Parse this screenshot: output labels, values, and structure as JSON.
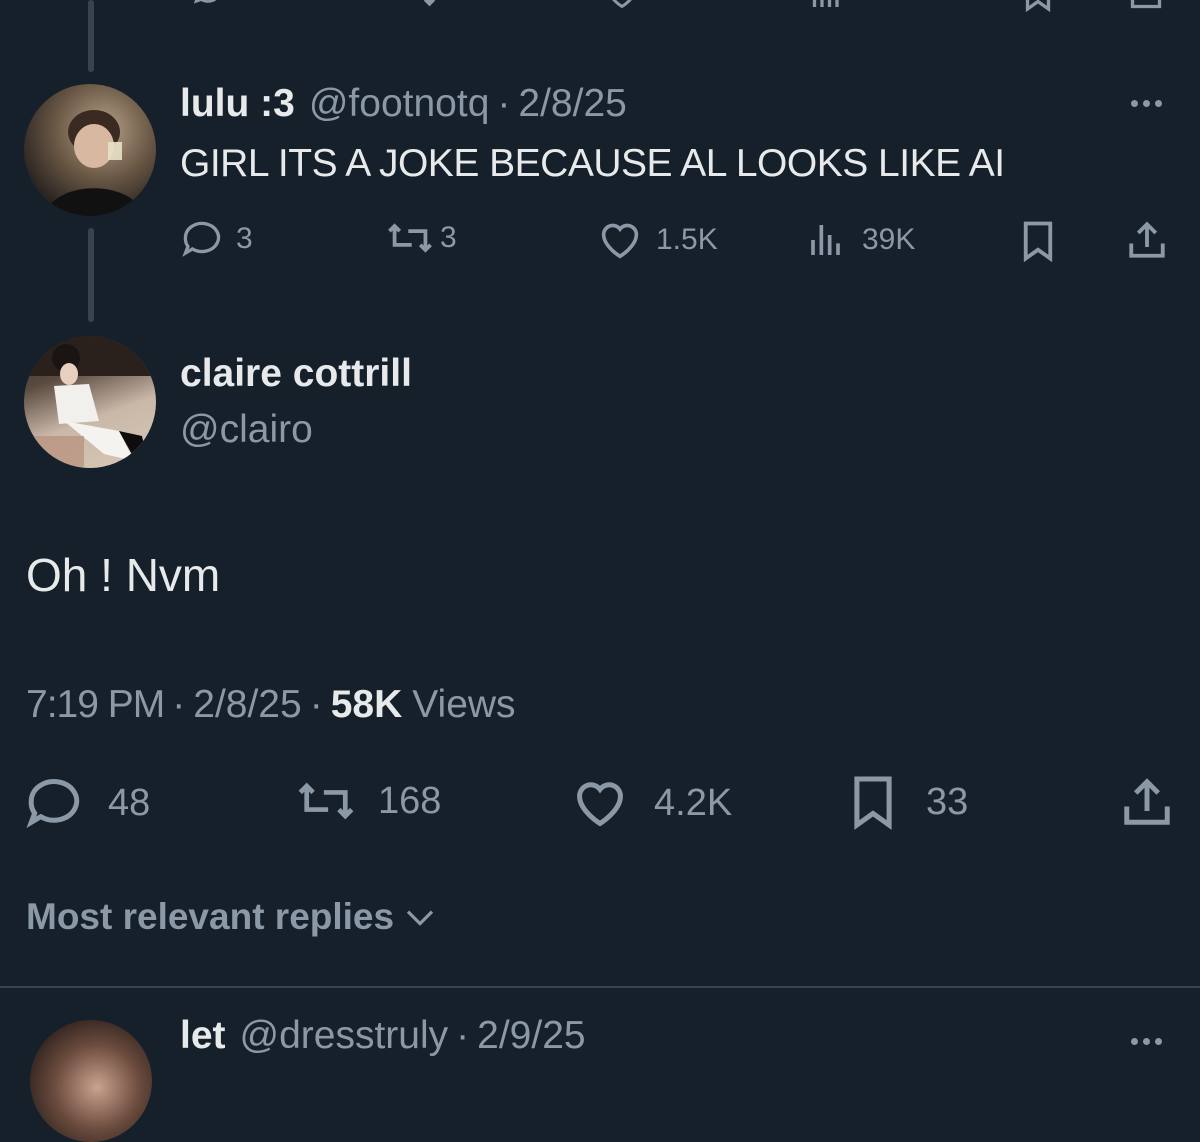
{
  "top_tweet_partial": {
    "icons": [
      "reply-icon",
      "retweet-icon",
      "like-icon",
      "views-icon",
      "bookmark-icon",
      "share-icon"
    ]
  },
  "reply1": {
    "display_name": "lulu :3",
    "handle": "@footnotq",
    "sep": "·",
    "date": "2/8/25",
    "text": "GIRL ITS A JOKE BECAUSE AL LOOKS LIKE AI",
    "stats": {
      "replies": "3",
      "retweets": "3",
      "likes": "1.5K",
      "views": "39K"
    }
  },
  "main_tweet": {
    "display_name": "claire cottrill",
    "handle": "@clairo",
    "text": "Oh ! Nvm",
    "time": "7:19 PM",
    "sep": "·",
    "date": "2/8/25",
    "views_count": "58K",
    "views_label": "Views",
    "stats": {
      "replies": "48",
      "retweets": "168",
      "likes": "4.2K",
      "bookmarks": "33"
    }
  },
  "replies_sort": {
    "label": "Most relevant replies"
  },
  "next_reply": {
    "display_name": "let",
    "handle": "@dresstruly",
    "sep": "·",
    "date": "2/9/25"
  },
  "colors": {
    "background": "#15202b",
    "text_primary": "#e7e9ea",
    "text_muted": "#8b98a5",
    "divider": "#38444d"
  }
}
